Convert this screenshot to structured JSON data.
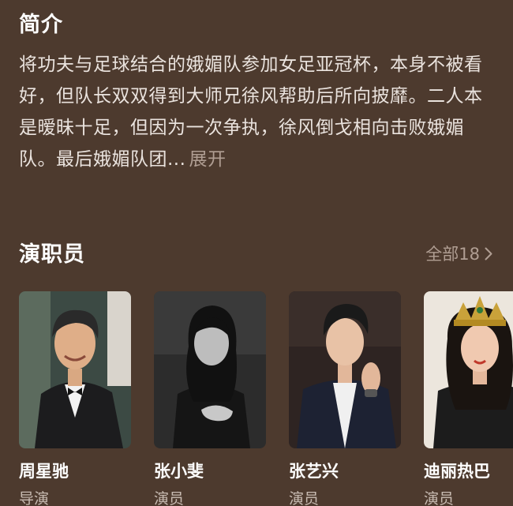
{
  "intro": {
    "title": "简介",
    "synopsis": "将功夫与足球结合的娥媚队参加女足亚冠杯，本身不被看好，但队长双双得到大师兄徐风帮助后所向披靡。二人本是暧昧十足，但因为一次争执，徐风倒戈相向击败娥媚队。最后娥媚队团...",
    "expand_label": "展开"
  },
  "cast": {
    "title": "演职员",
    "see_all_label": "全部18",
    "members": [
      {
        "name": "周星驰",
        "role": "导演",
        "photo": "person-photo"
      },
      {
        "name": "张小斐",
        "role": "演员",
        "photo": "person-photo"
      },
      {
        "name": "张艺兴",
        "role": "演员",
        "photo": "person-photo"
      },
      {
        "name": "迪丽热巴",
        "role": "演员",
        "photo": "person-photo"
      }
    ]
  },
  "colors": {
    "background": "#4d3a2e",
    "primary_text": "#ffffff",
    "secondary_text": "#b09e93"
  },
  "icons": {
    "see_all": "chevron-right-icon"
  }
}
